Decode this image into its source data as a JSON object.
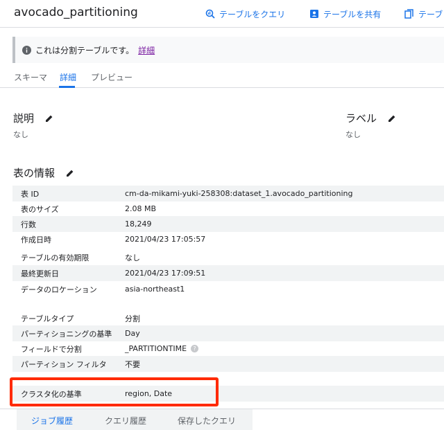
{
  "header": {
    "title": "avocado_partitioning",
    "query_button": "テーブルをクエリ",
    "share_button": "テーブルを共有",
    "copy_button": "テーブ"
  },
  "banner": {
    "text": "これは分割テーブルです。",
    "link": "詳細"
  },
  "tabs": [
    "スキーマ",
    "詳細",
    "プレビュー"
  ],
  "description": {
    "title": "説明",
    "value": "なし"
  },
  "labels": {
    "title": "ラベル",
    "value": "なし"
  },
  "table_info": {
    "title": "表の情報",
    "rows": [
      {
        "key": "表 ID",
        "value": "cm-da-mikami-yuki-258308:dataset_1.avocado_partitioning"
      },
      {
        "key": "表のサイズ",
        "value": "2.08 MB"
      },
      {
        "key": "行数",
        "value": "18,249"
      },
      {
        "key": "作成日時",
        "value": "2021/04/23 17:05:57"
      },
      {
        "key": "テーブルの有効期限",
        "value": "なし"
      },
      {
        "key": "最終更新日",
        "value": "2021/04/23 17:09:51"
      },
      {
        "key": "データのロケーション",
        "value": "asia-northeast1"
      },
      {
        "key": "テーブルタイプ",
        "value": "分割"
      },
      {
        "key": "パーティショニングの基準",
        "value": "Day"
      },
      {
        "key": "フィールドで分割",
        "value": "_PARTITIONTIME"
      },
      {
        "key": "パーティション フィルタ",
        "value": "不要"
      },
      {
        "key": "クラスタ化の基準",
        "value": "region, Date"
      }
    ]
  },
  "bottom_tabs": [
    "ジョブ履歴",
    "クエリ履歴",
    "保存したクエリ"
  ],
  "colors": {
    "accent": "#1a73e8",
    "highlight": "#ff2a00",
    "link_visited": "#7b1fa2"
  }
}
